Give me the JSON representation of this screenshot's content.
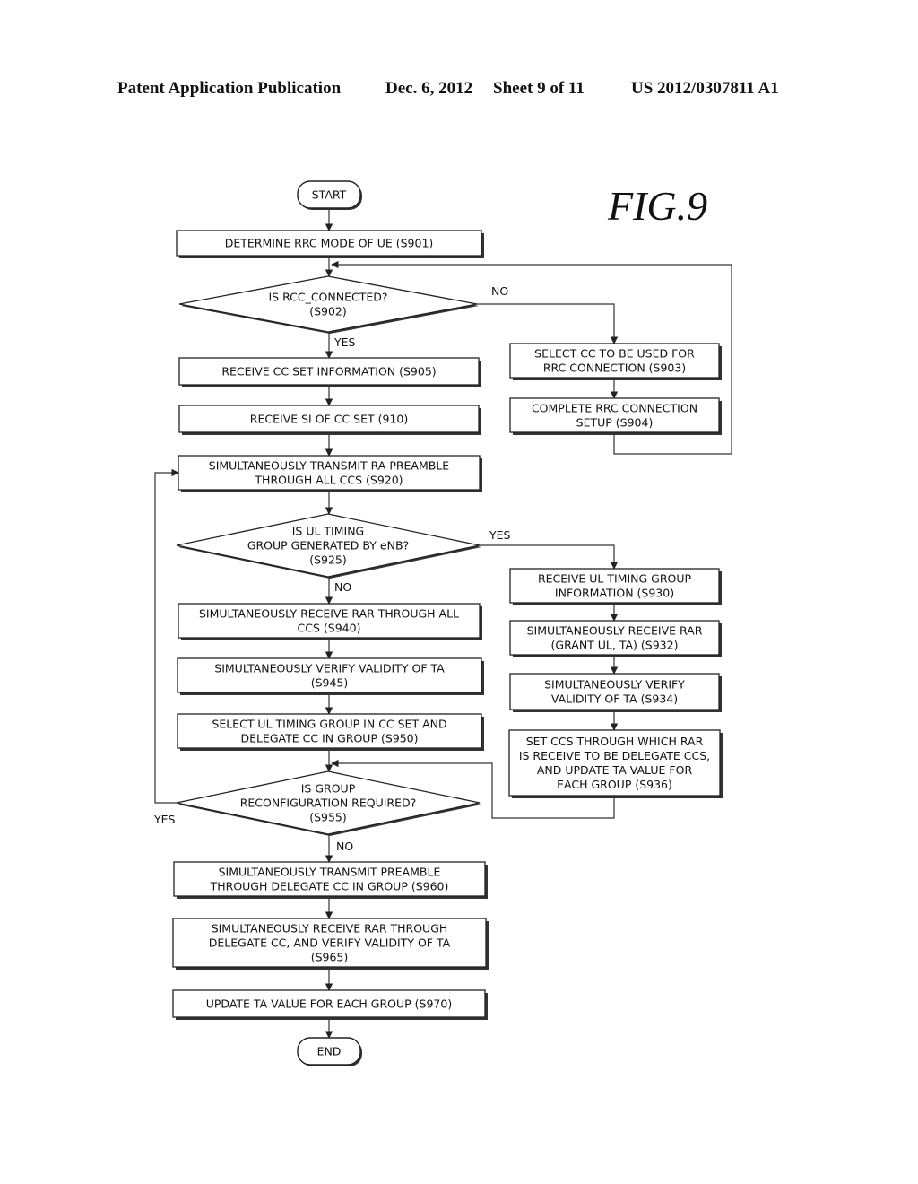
{
  "header": {
    "publication": "Patent Application Publication",
    "date": "Dec. 6, 2012",
    "sheet": "Sheet 9 of 11",
    "number": "US 2012/0307811 A1"
  },
  "figure_label": "FIG.9",
  "nodes": {
    "start": {
      "type": "terminal",
      "lines": [
        "START"
      ]
    },
    "s901": {
      "type": "process",
      "lines": [
        "DETERMINE RRC MODE OF UE (S901)"
      ]
    },
    "s902": {
      "type": "decision",
      "lines": [
        "IS RCC_CONNECTED?",
        "(S902)"
      ]
    },
    "s903": {
      "type": "process",
      "lines": [
        "SELECT CC TO BE USED FOR",
        "RRC CONNECTION (S903)"
      ]
    },
    "s904": {
      "type": "process",
      "lines": [
        "COMPLETE RRC CONNECTION",
        "SETUP (S904)"
      ]
    },
    "s905": {
      "type": "process",
      "lines": [
        "RECEIVE CC SET INFORMATION (S905)"
      ]
    },
    "s910": {
      "type": "process",
      "lines": [
        "RECEIVE SI OF CC SET (910)"
      ]
    },
    "s920": {
      "type": "process",
      "lines": [
        "SIMULTANEOUSLY TRANSMIT RA PREAMBLE",
        "THROUGH ALL CCS (S920)"
      ]
    },
    "s925": {
      "type": "decision",
      "lines": [
        "IS UL TIMING",
        "GROUP GENERATED BY eNB?",
        "(S925)"
      ]
    },
    "s930": {
      "type": "process",
      "lines": [
        "RECEIVE UL TIMING GROUP",
        "INFORMATION (S930)"
      ]
    },
    "s932": {
      "type": "process",
      "lines": [
        "SIMULTANEOUSLY RECEIVE RAR",
        "(GRANT UL, TA) (S932)"
      ]
    },
    "s934": {
      "type": "process",
      "lines": [
        "SIMULTANEOUSLY VERIFY",
        "VALIDITY OF TA (S934)"
      ]
    },
    "s936": {
      "type": "process",
      "lines": [
        "SET CCS THROUGH WHICH RAR",
        "IS RECEIVE TO BE DELEGATE CCS,",
        "AND UPDATE TA VALUE FOR",
        "EACH GROUP (S936)"
      ]
    },
    "s940": {
      "type": "process",
      "lines": [
        "SIMULTANEOUSLY RECEIVE RAR THROUGH ALL",
        "CCS (S940)"
      ]
    },
    "s945": {
      "type": "process",
      "lines": [
        "SIMULTANEOUSLY VERIFY VALIDITY OF TA",
        "(S945)"
      ]
    },
    "s950": {
      "type": "process",
      "lines": [
        "SELECT UL TIMING GROUP IN CC SET AND",
        "DELEGATE CC IN GROUP (S950)"
      ]
    },
    "s955": {
      "type": "decision",
      "lines": [
        "IS GROUP",
        "RECONFIGURATION REQUIRED?",
        "(S955)"
      ]
    },
    "s960": {
      "type": "process",
      "lines": [
        "SIMULTANEOUSLY TRANSMIT PREAMBLE",
        "THROUGH DELEGATE CC IN GROUP (S960)"
      ]
    },
    "s965": {
      "type": "process",
      "lines": [
        "SIMULTANEOUSLY RECEIVE RAR THROUGH",
        "DELEGATE CC, AND VERIFY VALIDITY OF TA",
        "(S965)"
      ]
    },
    "s970": {
      "type": "process",
      "lines": [
        "UPDATE TA VALUE FOR EACH GROUP (S970)"
      ]
    },
    "end": {
      "type": "terminal",
      "lines": [
        "END"
      ]
    }
  },
  "edge_labels": {
    "s902_no": "NO",
    "s902_yes": "YES",
    "s925_yes": "YES",
    "s925_no": "NO",
    "s955_yes": "YES",
    "s955_no": "NO"
  }
}
